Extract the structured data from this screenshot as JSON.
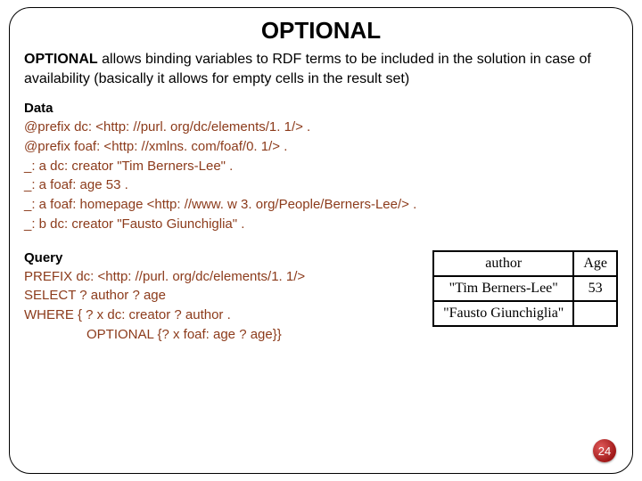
{
  "title": "OPTIONAL",
  "intro_kw": "OPTIONAL",
  "intro_rest": " allows binding variables to RDF terms to be included in the solution in case of availability (basically it allows for empty cells in the result set)",
  "data": {
    "heading": "Data",
    "lines": [
      "@prefix dc:   <http: //purl. org/dc/elements/1. 1/> .",
      "@prefix foaf: <http: //xmlns. com/foaf/0. 1/> .",
      "_: a dc: creator \"Tim Berners-Lee\" .",
      "_: a foaf: age 53 .",
      "_: a foaf: homepage <http: //www. w 3. org/People/Berners-Lee/> .",
      "_: b dc: creator \"Fausto Giunchiglia\" ."
    ]
  },
  "query": {
    "heading": "Query",
    "lines": [
      "PREFIX  dc:  <http: //purl. org/dc/elements/1. 1/>",
      "SELECT ? author ? age",
      "WHERE { ? x dc: creator ? author .",
      "OPTIONAL {? x foaf: age ? age}}"
    ]
  },
  "table": {
    "headers": [
      "author",
      "Age"
    ],
    "rows": [
      [
        "\"Tim Berners-Lee\"",
        "53"
      ],
      [
        "\"Fausto Giunchiglia\"",
        ""
      ]
    ]
  },
  "page_number": "24"
}
